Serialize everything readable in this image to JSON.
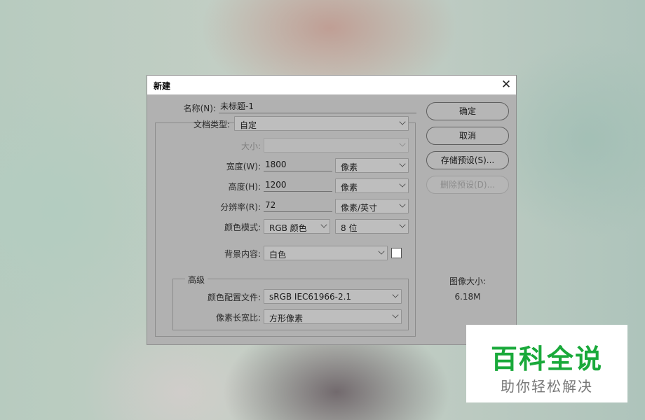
{
  "dialog": {
    "title": "新建",
    "close_icon": "✕"
  },
  "form": {
    "name_label": "名称(N):",
    "name_value": "未标题-1",
    "doc_type_label": "文档类型:",
    "doc_type_value": "自定",
    "size_label": "大小:",
    "size_value": "",
    "width_label": "宽度(W):",
    "width_value": "1800",
    "width_unit": "像素",
    "height_label": "高度(H):",
    "height_value": "1200",
    "height_unit": "像素",
    "resolution_label": "分辨率(R):",
    "resolution_value": "72",
    "resolution_unit": "像素/英寸",
    "color_mode_label": "颜色模式:",
    "color_mode_value": "RGB 颜色",
    "bit_depth_value": "8 位",
    "background_label": "背景内容:",
    "background_value": "白色",
    "background_swatch_color": "#ffffff"
  },
  "advanced": {
    "title": "高级",
    "color_profile_label": "颜色配置文件:",
    "color_profile_value": "sRGB IEC61966-2.1",
    "pixel_aspect_label": "像素长宽比:",
    "pixel_aspect_value": "方形像素"
  },
  "buttons": {
    "ok": "确定",
    "cancel": "取消",
    "save_preset": "存储预设(S)...",
    "delete_preset": "删除预设(D)..."
  },
  "image_size": {
    "label": "图像大小:",
    "value": "6.18M"
  },
  "watermark": {
    "title": "百科全说",
    "subtitle": "助你轻松解决",
    "title_color": "#19a93a"
  }
}
